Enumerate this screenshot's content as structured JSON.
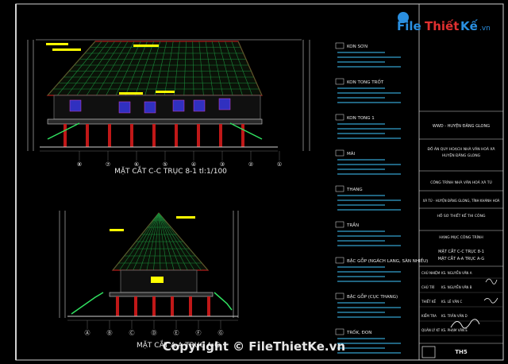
{
  "colors": {
    "background": "#000000",
    "frame": "#d0d0d0",
    "roof": "#b31b1b",
    "roofGrid": "#1a8a3a",
    "wall": "#6a6a6a",
    "window": "#3030c0",
    "text": "#e8e8e8",
    "cyan": "#40c8ff",
    "yellow": "#ffff00",
    "magenta": "#d040d0",
    "pillar": "#c01818",
    "green": "#30e060",
    "watermark": "#ffffff"
  },
  "section1": {
    "title": "MẶT CẮT C-C TRỤC 8-1 tl:1/100",
    "axis_labels": [
      "⑧",
      "⑦",
      "⑥",
      "⑤",
      "④",
      "③",
      "②",
      "①"
    ]
  },
  "section2": {
    "title": "MẶT CẮT A-A TRỤC A-G",
    "axis_labels": [
      "Ⓐ",
      "Ⓑ",
      "Ⓒ",
      "Ⓓ",
      "Ⓔ",
      "Ⓕ",
      "Ⓖ"
    ]
  },
  "legend": [
    {
      "label": "KON SƠN"
    },
    {
      "label": "KON TONG TRỐT"
    },
    {
      "label": "KON TONG 1"
    },
    {
      "label": "MÁI"
    },
    {
      "label": "THANG"
    },
    {
      "label": "TRẦN"
    },
    {
      "label": "BẬC GỖP (NGÁCH LANG, SÀN NHIỀU)"
    },
    {
      "label": "BẬC GỖP (CỤC THANG)"
    },
    {
      "label": "TRỐK, ĐON"
    }
  ],
  "title_block": {
    "client": "WWD - HUYỆN ĐĂNG GLONG",
    "project": "ĐỒ ÁN QUY HOẠCH NHÀ VĂN HOÁ XÃ",
    "project2": "HUYỆN ĐĂNG GLONG",
    "work": "CÔNG TRÌNH NHÀ VĂN HOÁ XÃ TÚ",
    "location": "XÃ TÚ - HUYỆN ĐĂNG GLONG, TỈNH KHÁNH HOÀ",
    "stage": "HỒ SƠ THIẾT KẾ THI CÔNG",
    "category": "HẠNG MỤC CÔNG TRÌNH",
    "sheet_name1": "MẶT CẮT C-C TRỤC 8-1",
    "sheet_name2": "MẶT CẮT A-A TRỤC A-G",
    "sheet_code": "TH5",
    "roles": [
      "CHỦ NHIỆM",
      "CHỦ TRÌ",
      "THIẾT KẾ",
      "KIỂM TRA",
      "QUẢN LÝ KT"
    ],
    "names": [
      "KS. NGUYỄN VĂN A",
      "KS. NGUYỄN VĂN B",
      "KS. LÊ VĂN C",
      "KS. TRẦN VĂN D",
      "KS. PHẠM VĂN E"
    ]
  },
  "logo": {
    "prefix": "File",
    "middle": "Thiết",
    "suffix": "Kế",
    "tld": ".vn"
  },
  "watermark": "Copyright © FileThietKe.vn"
}
